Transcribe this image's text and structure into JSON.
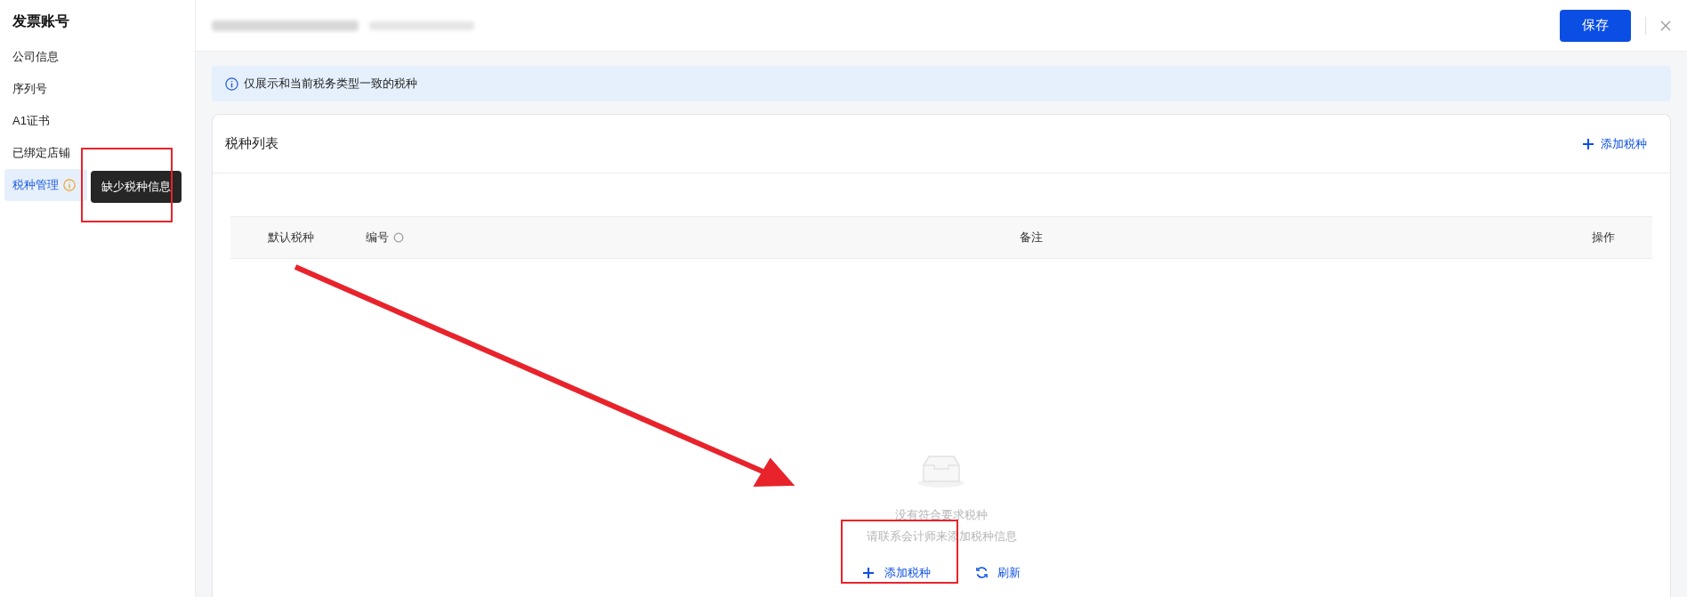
{
  "sidebar": {
    "title": "发票账号",
    "items": [
      {
        "label": "公司信息",
        "selected": false,
        "warning": false
      },
      {
        "label": "序列号",
        "selected": false,
        "warning": false
      },
      {
        "label": "A1证书",
        "selected": false,
        "warning": false
      },
      {
        "label": "已绑定店铺",
        "selected": false,
        "warning": false
      },
      {
        "label": "税种管理",
        "selected": true,
        "warning": true
      }
    ],
    "tooltip": "缺少税种信息"
  },
  "header": {
    "save_button": "保存"
  },
  "info_banner": "仅展示和当前税务类型一致的税种",
  "card": {
    "title": "税种列表",
    "add_button": "添加税种",
    "table": {
      "columns": [
        {
          "label": "默认税种",
          "sortable": false
        },
        {
          "label": "编号",
          "sortable": true
        },
        {
          "label": "备注",
          "sortable": false
        },
        {
          "label": "操作",
          "sortable": false
        }
      ]
    },
    "empty_state": {
      "title": "没有符合要求税种",
      "hint": "请联系会计师来添加税种信息",
      "add_button": "添加税种",
      "refresh_button": "刷新"
    }
  }
}
